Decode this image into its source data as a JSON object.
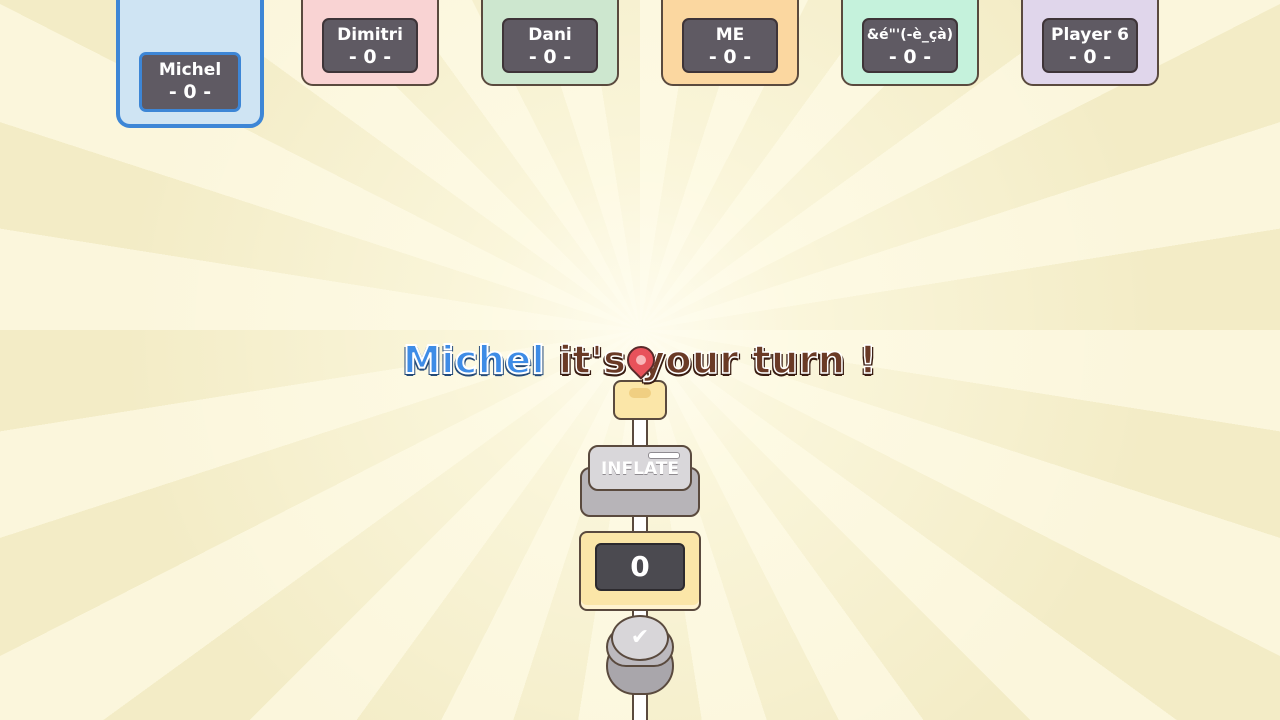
{
  "players": [
    {
      "name": "Michel",
      "score": "- 0 -",
      "color": "#cfe4f3",
      "active": true
    },
    {
      "name": "Dimitri",
      "score": "- 0 -",
      "color": "#f9d3d3",
      "active": false
    },
    {
      "name": "Dani",
      "score": "- 0 -",
      "color": "#cde7cf",
      "active": false
    },
    {
      "name": "ME",
      "score": "- 0 -",
      "color": "#fbd7a0",
      "active": false
    },
    {
      "name": "&é\"'(-è_çà)",
      "score": "- 0 -",
      "color": "#c5f2dc",
      "active": false
    },
    {
      "name": "Player 6",
      "score": "- 0 -",
      "color": "#e0d6eb",
      "active": false
    }
  ],
  "turn": {
    "player_name": "Michel",
    "message": "it's your turn !"
  },
  "controls": {
    "inflate_label": "INFLATE",
    "counter_value": "0",
    "confirm_icon": "checkmark-icon"
  },
  "colors": {
    "accent_blue": "#3d86d6",
    "text_brown": "#6a3a26",
    "pin_red": "#e8525b",
    "background": "#f6f0cf"
  }
}
